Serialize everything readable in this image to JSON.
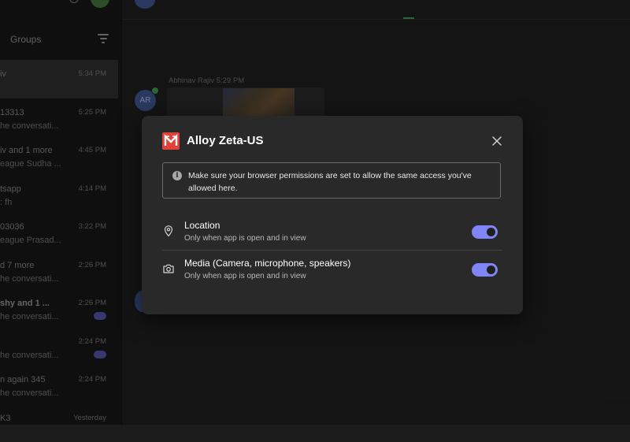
{
  "sidebar": {
    "groups_label": "Groups",
    "chats": [
      {
        "name": "iv",
        "preview": "",
        "time": "5:34 PM",
        "active": true,
        "bold": false,
        "badge": false
      },
      {
        "name": "13313",
        "preview": "he conversati...",
        "time": "5:25 PM",
        "active": false,
        "bold": false,
        "badge": false
      },
      {
        "name": "iv and 1 more",
        "preview": "eague Sudha ...",
        "time": "4:45 PM",
        "active": false,
        "bold": false,
        "badge": false
      },
      {
        "name": "tsapp",
        "preview": ": fh",
        "time": "4:14 PM",
        "active": false,
        "bold": false,
        "badge": false
      },
      {
        "name": "03036",
        "preview": "eague Prasad...",
        "time": "3:22 PM",
        "active": false,
        "bold": false,
        "badge": false
      },
      {
        "name": "d 7 more",
        "preview": "he conversati...",
        "time": "2:26 PM",
        "active": false,
        "bold": false,
        "badge": false
      },
      {
        "name": "shy and 1 ...",
        "preview": "he conversati...",
        "time": "2:26 PM",
        "active": false,
        "bold": true,
        "badge": true
      },
      {
        "name": "",
        "preview": "he conversati...",
        "time": "2:24 PM",
        "active": false,
        "bold": false,
        "badge": true
      },
      {
        "name": "n again 345",
        "preview": "he conversati...",
        "time": "2:24 PM",
        "active": false,
        "bold": false,
        "badge": false
      },
      {
        "name": "K3",
        "preview": "",
        "time": "Yesterday",
        "active": false,
        "bold": false,
        "badge": false
      }
    ]
  },
  "conversation": {
    "message_avatar": "AR",
    "message_meta": "Abhinav Rajiv 5:29 PM"
  },
  "dialog": {
    "title": "Alloy Zeta-US",
    "logo_color": "#e2403a",
    "close_icon": "close-icon",
    "info_icon": "info-icon",
    "info_text": "Make sure your browser permissions are set to allow the same access you've allowed here.",
    "permissions": [
      {
        "icon": "location-pin-icon",
        "title": "Location",
        "subtitle": "Only when app is open and in view",
        "enabled": true
      },
      {
        "icon": "camera-icon",
        "title": "Media (Camera, microphone, speakers)",
        "subtitle": "Only when app is open and in view",
        "enabled": true
      }
    ],
    "toggle_color": "#7f85f5"
  }
}
